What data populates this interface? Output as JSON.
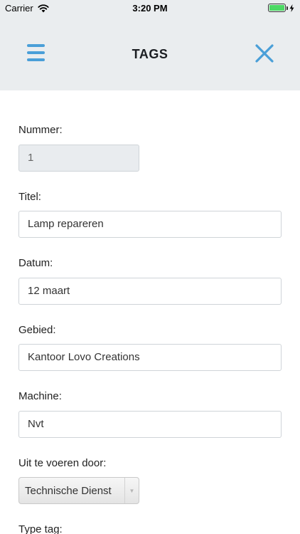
{
  "status_bar": {
    "carrier": "Carrier",
    "time": "3:20 PM"
  },
  "nav": {
    "title": "TAGS",
    "menu_icon": "hamburger-icon",
    "close_icon": "close-icon",
    "accent": "#4a9fd8"
  },
  "form": {
    "nummer": {
      "label": "Nummer:",
      "value": "1"
    },
    "titel": {
      "label": "Titel:",
      "value": "Lamp repareren"
    },
    "datum": {
      "label": "Datum:",
      "value": "12 maart"
    },
    "gebied": {
      "label": "Gebied:",
      "value": "Kantoor Lovo Creations"
    },
    "machine": {
      "label": "Machine:",
      "value": "Nvt"
    },
    "uitvoerder": {
      "label": "Uit te voeren door:",
      "selected": "Technische Dienst"
    },
    "type_tag": {
      "label": "Type tag:"
    }
  }
}
